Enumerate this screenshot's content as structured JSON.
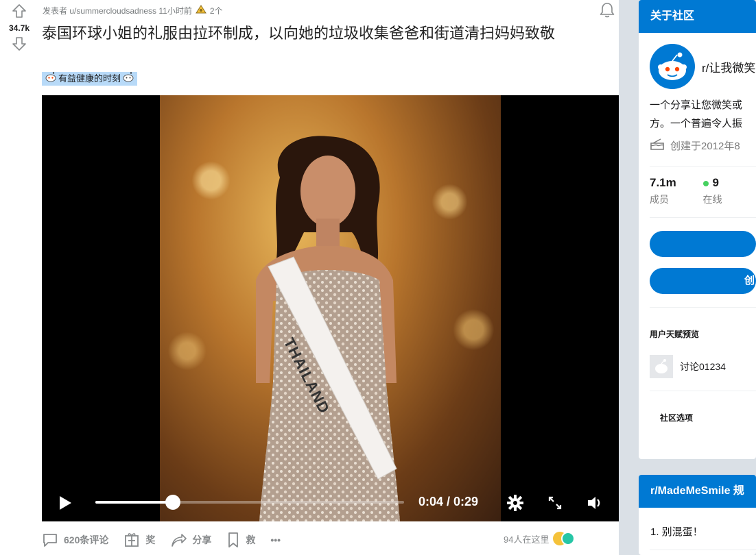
{
  "post": {
    "vote_count": "34.7k",
    "meta_prefix": "发表者 u/summercloudsadness 11小时前",
    "award_count": "2个",
    "title": "泰国环球小姐的礼服由拉环制成，以向她的垃圾收集爸爸和街道清扫妈妈致敬",
    "flair": "有益健康的时刻"
  },
  "video": {
    "time": "0:04 / 0:29",
    "progress_fraction": 0.25,
    "sash_text": "THAILAND"
  },
  "actions": {
    "comments": "620条评论",
    "award": "奖",
    "share": "分享",
    "save": "救",
    "more": "•••",
    "online": "94人在这里"
  },
  "sidebar": {
    "about_header": "关于社区",
    "community_name": "r/让我微笑",
    "description_line1": "一个分享让您微笑或",
    "description_line2": "方。一个普遍令人振",
    "created": "创建于2012年8",
    "members_value": "7.1m",
    "members_label": "成员",
    "online_value": "9",
    "online_label": "在线",
    "create_button": "创",
    "talent_label": "用户天赋预览",
    "talent_user": "讨论01234",
    "options_label": "社区选项",
    "rules_header": "r/MadeMeSmile 规",
    "rule_1": "1. 别混蛋！"
  },
  "colors": {
    "accent": "#0079d3",
    "flair_bg": "#b8daf8",
    "online_dot": "#46d160"
  }
}
